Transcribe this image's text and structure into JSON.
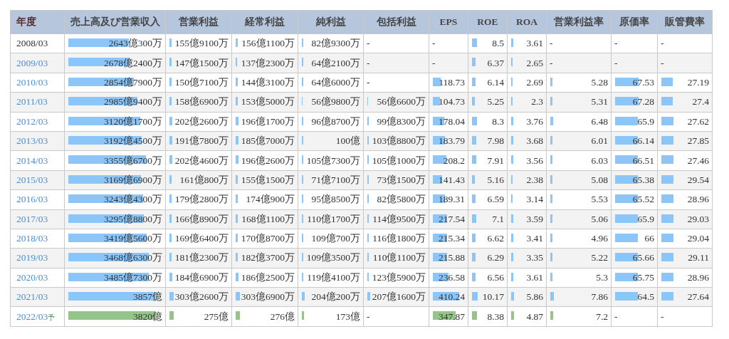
{
  "table": {
    "columns": [
      "年度",
      "売上高及び営業収入",
      "営業利益",
      "経常利益",
      "純利益",
      "包括利益",
      "EPS",
      "ROE",
      "ROA",
      "営業利益率",
      "原価率",
      "販管費率"
    ],
    "rows": [
      {
        "kind": "actual",
        "cells": [
          {
            "text": "2008/03",
            "linked": false
          },
          {
            "text": "2643億300万",
            "level": 0.65
          },
          {
            "text": "155億9100万",
            "level": 0.04
          },
          {
            "text": "156億1100万",
            "level": 0.04
          },
          {
            "text": "82億9300万",
            "level": 0.02
          },
          {
            "text": "-"
          },
          {
            "text": "-"
          },
          {
            "text": "8.5",
            "level": 0.15
          },
          {
            "text": "3.61",
            "level": 0.06
          },
          {
            "text": "-"
          },
          {
            "text": "-"
          },
          {
            "text": "-"
          }
        ]
      },
      {
        "kind": "actual",
        "cells": [
          {
            "text": "2009/03",
            "linked": true
          },
          {
            "text": "2678億2400万",
            "level": 0.66
          },
          {
            "text": "147億1500万",
            "level": 0.04
          },
          {
            "text": "137億2300万",
            "level": 0.03
          },
          {
            "text": "64億2100万",
            "level": 0.02
          },
          {
            "text": "-"
          },
          {
            "text": "-"
          },
          {
            "text": "6.37",
            "level": 0.11
          },
          {
            "text": "2.65",
            "level": 0.04
          },
          {
            "text": "-"
          },
          {
            "text": "-"
          },
          {
            "text": "-"
          }
        ]
      },
      {
        "kind": "actual",
        "cells": [
          {
            "text": "2010/03",
            "linked": true
          },
          {
            "text": "2854億7900万",
            "level": 0.7
          },
          {
            "text": "150億7100万",
            "level": 0.04
          },
          {
            "text": "144億3100万",
            "level": 0.04
          },
          {
            "text": "64億6000万",
            "level": 0.02
          },
          {
            "text": "-"
          },
          {
            "text": "118.73",
            "level": 0.25
          },
          {
            "text": "6.14",
            "level": 0.11
          },
          {
            "text": "2.69",
            "level": 0.04
          },
          {
            "text": "5.28",
            "level": 0.04
          },
          {
            "text": "67.53",
            "level": 0.61
          },
          {
            "text": "27.19",
            "level": 0.24
          }
        ]
      },
      {
        "kind": "actual",
        "cells": [
          {
            "text": "2011/03",
            "linked": true
          },
          {
            "text": "2985億9400万",
            "level": 0.74
          },
          {
            "text": "158億6900万",
            "level": 0.04
          },
          {
            "text": "153億5000万",
            "level": 0.04
          },
          {
            "text": "56億9800万",
            "level": 0.01
          },
          {
            "text": "56億6600万",
            "level": 0.01
          },
          {
            "text": "104.73",
            "level": 0.22
          },
          {
            "text": "5.25",
            "level": 0.09
          },
          {
            "text": "2.3",
            "level": 0.04
          },
          {
            "text": "5.31",
            "level": 0.04
          },
          {
            "text": "67.28",
            "level": 0.61
          },
          {
            "text": "27.4",
            "level": 0.24
          }
        ]
      },
      {
        "kind": "actual",
        "cells": [
          {
            "text": "2012/03",
            "linked": true
          },
          {
            "text": "3120億1700万",
            "level": 0.77
          },
          {
            "text": "202億2600万",
            "level": 0.05
          },
          {
            "text": "196億1700万",
            "level": 0.05
          },
          {
            "text": "96億8700万",
            "level": 0.02
          },
          {
            "text": "99億8300万",
            "level": 0.02
          },
          {
            "text": "178.04",
            "level": 0.37
          },
          {
            "text": "8.3",
            "level": 0.15
          },
          {
            "text": "3.76",
            "level": 0.06
          },
          {
            "text": "6.48",
            "level": 0.05
          },
          {
            "text": "65.9",
            "level": 0.6
          },
          {
            "text": "27.62",
            "level": 0.25
          }
        ]
      },
      {
        "kind": "actual",
        "cells": [
          {
            "text": "2013/03",
            "linked": true
          },
          {
            "text": "3192億4500万",
            "level": 0.79
          },
          {
            "text": "191億7800万",
            "level": 0.05
          },
          {
            "text": "185億7000万",
            "level": 0.05
          },
          {
            "text": "100億",
            "level": 0.02
          },
          {
            "text": "103億8800万",
            "level": 0.03
          },
          {
            "text": "183.79",
            "level": 0.38
          },
          {
            "text": "7.98",
            "level": 0.14
          },
          {
            "text": "3.68",
            "level": 0.06
          },
          {
            "text": "6.01",
            "level": 0.04
          },
          {
            "text": "66.14",
            "level": 0.6
          },
          {
            "text": "27.85",
            "level": 0.25
          }
        ]
      },
      {
        "kind": "actual",
        "cells": [
          {
            "text": "2014/03",
            "linked": true
          },
          {
            "text": "3355億6700万",
            "level": 0.83
          },
          {
            "text": "202億4600万",
            "level": 0.05
          },
          {
            "text": "196億2600万",
            "level": 0.05
          },
          {
            "text": "105億7300万",
            "level": 0.03
          },
          {
            "text": "105億1000万",
            "level": 0.03
          },
          {
            "text": "208.2",
            "level": 0.43
          },
          {
            "text": "7.91",
            "level": 0.14
          },
          {
            "text": "3.56",
            "level": 0.06
          },
          {
            "text": "6.03",
            "level": 0.04
          },
          {
            "text": "66.51",
            "level": 0.6
          },
          {
            "text": "27.46",
            "level": 0.25
          }
        ]
      },
      {
        "kind": "actual",
        "cells": [
          {
            "text": "2015/03",
            "linked": true
          },
          {
            "text": "3169億6900万",
            "level": 0.78
          },
          {
            "text": "161億800万",
            "level": 0.04
          },
          {
            "text": "155億1500万",
            "level": 0.04
          },
          {
            "text": "71億7100万",
            "level": 0.02
          },
          {
            "text": "73億1500万",
            "level": 0.02
          },
          {
            "text": "141.43",
            "level": 0.29
          },
          {
            "text": "5.16",
            "level": 0.09
          },
          {
            "text": "2.38",
            "level": 0.04
          },
          {
            "text": "5.08",
            "level": 0.04
          },
          {
            "text": "65.38",
            "level": 0.59
          },
          {
            "text": "29.54",
            "level": 0.26
          }
        ]
      },
      {
        "kind": "actual",
        "cells": [
          {
            "text": "2016/03",
            "linked": true
          },
          {
            "text": "3243億4300万",
            "level": 0.8
          },
          {
            "text": "179億2800万",
            "level": 0.04
          },
          {
            "text": "174億900万",
            "level": 0.04
          },
          {
            "text": "95億8500万",
            "level": 0.02
          },
          {
            "text": "82億5800万",
            "level": 0.02
          },
          {
            "text": "189.31",
            "level": 0.39
          },
          {
            "text": "6.59",
            "level": 0.12
          },
          {
            "text": "3.14",
            "level": 0.05
          },
          {
            "text": "5.53",
            "level": 0.04
          },
          {
            "text": "65.52",
            "level": 0.6
          },
          {
            "text": "28.96",
            "level": 0.26
          }
        ]
      },
      {
        "kind": "actual",
        "cells": [
          {
            "text": "2017/03",
            "linked": true
          },
          {
            "text": "3295億8800万",
            "level": 0.81
          },
          {
            "text": "166億8900万",
            "level": 0.04
          },
          {
            "text": "168億1100万",
            "level": 0.04
          },
          {
            "text": "110億1700万",
            "level": 0.03
          },
          {
            "text": "114億9500万",
            "level": 0.03
          },
          {
            "text": "217.54",
            "level": 0.45
          },
          {
            "text": "7.1",
            "level": 0.13
          },
          {
            "text": "3.59",
            "level": 0.06
          },
          {
            "text": "5.06",
            "level": 0.04
          },
          {
            "text": "65.9",
            "level": 0.6
          },
          {
            "text": "29.03",
            "level": 0.26
          }
        ]
      },
      {
        "kind": "actual",
        "cells": [
          {
            "text": "2018/03",
            "linked": true
          },
          {
            "text": "3419億5600万",
            "level": 0.84
          },
          {
            "text": "169億6400万",
            "level": 0.04
          },
          {
            "text": "170億8700万",
            "level": 0.04
          },
          {
            "text": "109億700万",
            "level": 0.03
          },
          {
            "text": "116億1800万",
            "level": 0.03
          },
          {
            "text": "215.34",
            "level": 0.45
          },
          {
            "text": "6.62",
            "level": 0.12
          },
          {
            "text": "3.41",
            "level": 0.06
          },
          {
            "text": "4.96",
            "level": 0.04
          },
          {
            "text": "66",
            "level": 0.6
          },
          {
            "text": "29.04",
            "level": 0.26
          }
        ]
      },
      {
        "kind": "actual",
        "cells": [
          {
            "text": "2019/03",
            "linked": true
          },
          {
            "text": "3468億6300万",
            "level": 0.86
          },
          {
            "text": "181億2300万",
            "level": 0.04
          },
          {
            "text": "182億3700万",
            "level": 0.04
          },
          {
            "text": "109億3500万",
            "level": 0.03
          },
          {
            "text": "110億1100万",
            "level": 0.03
          },
          {
            "text": "215.88",
            "level": 0.45
          },
          {
            "text": "6.29",
            "level": 0.11
          },
          {
            "text": "3.35",
            "level": 0.06
          },
          {
            "text": "5.22",
            "level": 0.04
          },
          {
            "text": "65.66",
            "level": 0.6
          },
          {
            "text": "29.11",
            "level": 0.26
          }
        ]
      },
      {
        "kind": "actual",
        "cells": [
          {
            "text": "2020/03",
            "linked": true
          },
          {
            "text": "3485億7300万",
            "level": 0.86
          },
          {
            "text": "184億6900万",
            "level": 0.05
          },
          {
            "text": "186億2500万",
            "level": 0.05
          },
          {
            "text": "119億4100万",
            "level": 0.03
          },
          {
            "text": "123億5900万",
            "level": 0.03
          },
          {
            "text": "236.58",
            "level": 0.49
          },
          {
            "text": "6.56",
            "level": 0.12
          },
          {
            "text": "3.61",
            "level": 0.06
          },
          {
            "text": "5.3",
            "level": 0.04
          },
          {
            "text": "65.75",
            "level": 0.6
          },
          {
            "text": "28.96",
            "level": 0.26
          }
        ]
      },
      {
        "kind": "actual",
        "cells": [
          {
            "text": "2021/03",
            "linked": true
          },
          {
            "text": "3857億",
            "level": 0.95
          },
          {
            "text": "303億2600万",
            "level": 0.07
          },
          {
            "text": "303億6900万",
            "level": 0.07
          },
          {
            "text": "204億200万",
            "level": 0.05
          },
          {
            "text": "207億1600万",
            "level": 0.05
          },
          {
            "text": "410.24",
            "level": 0.85
          },
          {
            "text": "10.17",
            "level": 0.18
          },
          {
            "text": "5.86",
            "level": 0.1
          },
          {
            "text": "7.86",
            "level": 0.06
          },
          {
            "text": "64.5",
            "level": 0.59
          },
          {
            "text": "27.64",
            "level": 0.25
          }
        ]
      },
      {
        "kind": "forecast",
        "cells": [
          {
            "text": "2022/03",
            "note": "予",
            "linked": true
          },
          {
            "text": "3820億",
            "level": 0.94
          },
          {
            "text": "275億",
            "level": 0.07
          },
          {
            "text": "276億",
            "level": 0.07
          },
          {
            "text": "173億",
            "level": 0.04
          },
          {
            "text": "-"
          },
          {
            "text": "347.87",
            "level": 0.72
          },
          {
            "text": "8.38",
            "level": 0.15
          },
          {
            "text": "4.87",
            "level": 0.08
          },
          {
            "text": "7.2",
            "level": 0.05
          },
          {
            "text": "-"
          },
          {
            "text": "-"
          }
        ]
      }
    ]
  }
}
